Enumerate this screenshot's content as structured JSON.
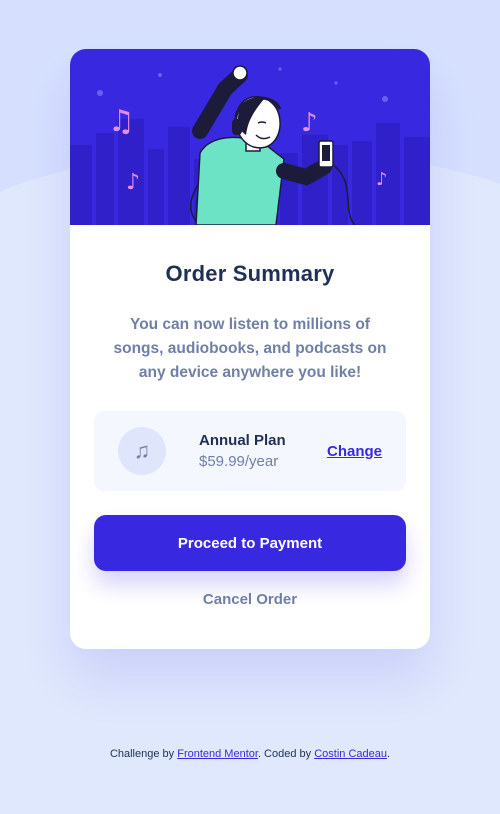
{
  "card": {
    "title": "Order Summary",
    "description": "You can now listen to millions of songs, audiobooks, and podcasts on any device anywhere you like!",
    "plan": {
      "icon": "music-note-icon",
      "name": "Annual Plan",
      "price": "$59.99/year",
      "change_label": "Change"
    },
    "pay_label": "Proceed to Payment",
    "cancel_label": "Cancel Order"
  },
  "attribution": {
    "prefix": "Challenge by ",
    "fm_link": "Frontend Mentor",
    "middle": ". Coded by ",
    "author_link": "Costin Cadeau",
    "suffix": "."
  },
  "colors": {
    "primary": "#3829e0",
    "dark_text": "#1f2f56",
    "muted_text": "#717fa6",
    "plan_bg": "#f5f7ff",
    "page_bg": "#e0e8fd"
  }
}
